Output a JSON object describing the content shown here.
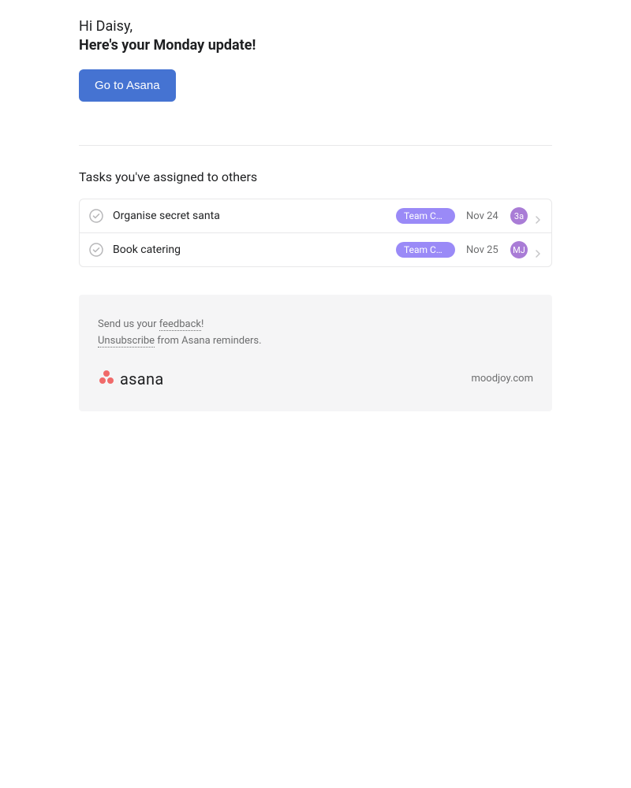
{
  "header": {
    "greeting": "Hi Daisy,",
    "update_title": "Here's your Monday update!",
    "cta_label": "Go to Asana"
  },
  "tasks_section": {
    "title": "Tasks you've assigned to others",
    "tasks": [
      {
        "title": "Organise secret santa",
        "tag": "Team Ch…",
        "due": "Nov 24",
        "assignee_initials": "3a"
      },
      {
        "title": "Book catering",
        "tag": "Team Ch…",
        "due": "Nov 25",
        "assignee_initials": "MJ"
      }
    ]
  },
  "footer": {
    "feedback_prefix": "Send us your ",
    "feedback_link": "feedback",
    "feedback_suffix": "!",
    "unsubscribe_link": "Unsubscribe",
    "unsubscribe_suffix": " from Asana reminders.",
    "logo_text": "asana",
    "domain": "moodjoy.com"
  }
}
